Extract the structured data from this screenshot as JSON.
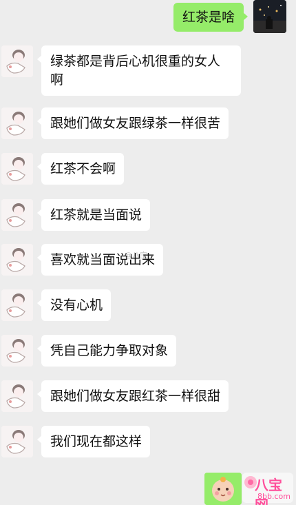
{
  "outgoing": {
    "top_message": "红茶是啥"
  },
  "incoming": [
    {
      "text": "绿茶都是背后心机很重的女人啊"
    },
    {
      "text": "跟她们做女友跟绿茶一样很苦"
    },
    {
      "text": "红茶不会啊"
    },
    {
      "text": "红茶就是当面说"
    },
    {
      "text": "喜欢就当面说出来"
    },
    {
      "text": "没有心机"
    },
    {
      "text": "凭自己能力争取对象"
    },
    {
      "text": "跟她们做女友跟红茶一样很甜"
    },
    {
      "text": "我们现在都这样"
    }
  ],
  "watermark": {
    "center_text": "@八宝",
    "logo_text": "八宝网",
    "logo_url_text": "8bb.com"
  },
  "colors": {
    "background": "#ededed",
    "incoming_bubble": "#ffffff",
    "outgoing_bubble": "#95ec69"
  }
}
